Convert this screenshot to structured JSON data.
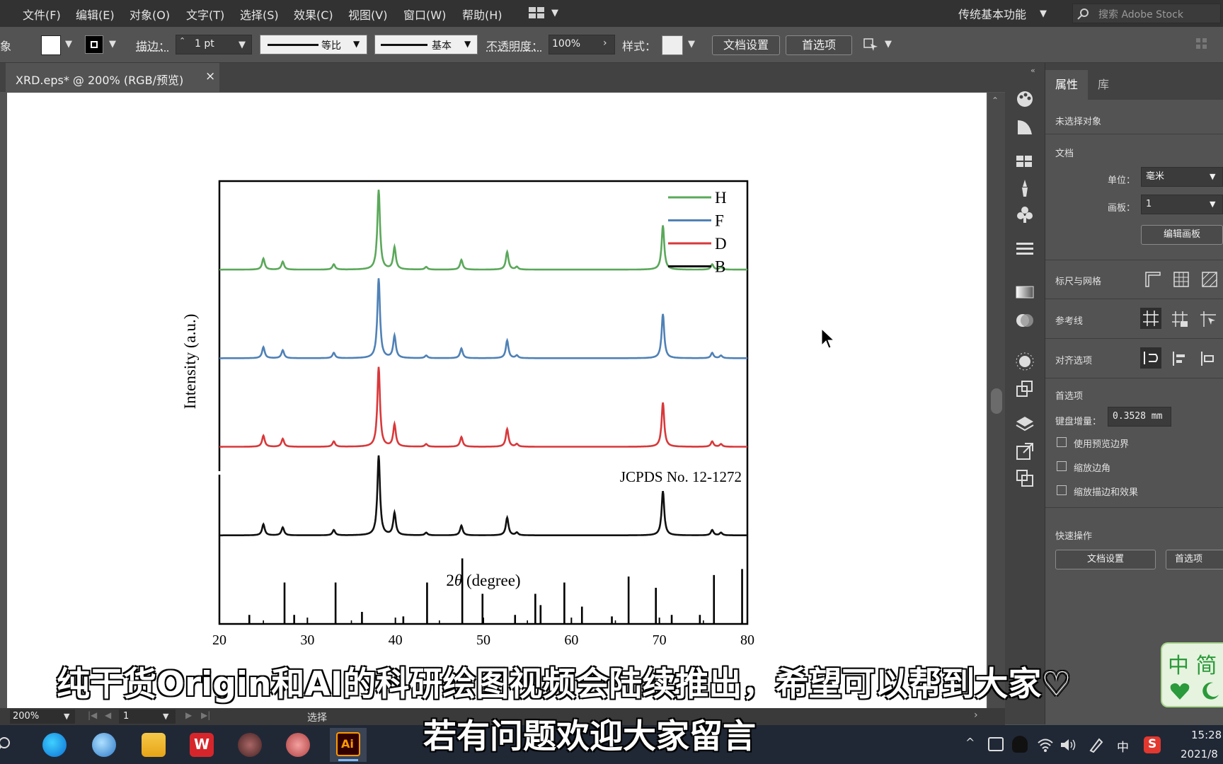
{
  "menubar": {
    "items": [
      "文件(F)",
      "编辑(E)",
      "对象(O)",
      "文字(T)",
      "选择(S)",
      "效果(C)",
      "视图(V)",
      "窗口(W)",
      "帮助(H)"
    ],
    "workspace": "传统基本功能",
    "search_placeholder": "搜索 Adobe Stock"
  },
  "controlbar": {
    "left_cut_label": "象",
    "stroke_label": "描边：",
    "stroke_weight": "1 pt",
    "profile_label": "等比",
    "brush_label": "基本",
    "opacity_label": "不透明度：",
    "opacity_value": "100%",
    "style_label": "样式：",
    "doc_setup_button": "文档设置",
    "prefs_button": "首选项"
  },
  "document_tab": {
    "title": "XRD.eps* @ 200% (RGB/预览)",
    "close": "×"
  },
  "chart_data": {
    "type": "line",
    "xlabel_prefix": "2",
    "xlabel_theta": "θ",
    "xlabel_rest": " (degree)",
    "ylabel": "Intensity (a.u.)",
    "xlim": [
      20,
      80
    ],
    "xticks": [
      "20",
      "30",
      "40",
      "50",
      "60",
      "70",
      "80"
    ],
    "reference_label": "JCPDS No. 12-1272",
    "series": [
      {
        "name": "H",
        "color": "#5aa85a",
        "baseline": 0.8,
        "offset_label_order": 0
      },
      {
        "name": "F",
        "color": "#4f81b6",
        "baseline": 0.6,
        "offset_label_order": 1
      },
      {
        "name": "D",
        "color": "#d9383a",
        "baseline": 0.4,
        "offset_label_order": 2
      },
      {
        "name": "B",
        "color": "#111111",
        "baseline": 0.2,
        "offset_label_order": 3
      }
    ],
    "peaks": [
      {
        "x": 25.0,
        "h": 0.025
      },
      {
        "x": 27.2,
        "h": 0.018
      },
      {
        "x": 33.0,
        "h": 0.012
      },
      {
        "x": 38.1,
        "h": 0.18
      },
      {
        "x": 39.9,
        "h": 0.05
      },
      {
        "x": 43.5,
        "h": 0.006
      },
      {
        "x": 47.5,
        "h": 0.022
      },
      {
        "x": 52.7,
        "h": 0.04
      },
      {
        "x": 53.8,
        "h": 0.006
      },
      {
        "x": 70.4,
        "h": 0.1
      },
      {
        "x": 76.0,
        "h": 0.012
      },
      {
        "x": 77.0,
        "h": 0.006
      }
    ],
    "reference_lines": [
      {
        "x": 23.4,
        "h": 0.12
      },
      {
        "x": 27.4,
        "h": 0.55
      },
      {
        "x": 28.5,
        "h": 0.12
      },
      {
        "x": 33.2,
        "h": 0.55
      },
      {
        "x": 36.2,
        "h": 0.16
      },
      {
        "x": 40.9,
        "h": 0.1
      },
      {
        "x": 43.6,
        "h": 0.55
      },
      {
        "x": 47.6,
        "h": 0.87
      },
      {
        "x": 49.9,
        "h": 0.4
      },
      {
        "x": 53.6,
        "h": 0.12
      },
      {
        "x": 55.9,
        "h": 0.4
      },
      {
        "x": 56.5,
        "h": 0.25
      },
      {
        "x": 59.2,
        "h": 0.55
      },
      {
        "x": 61.2,
        "h": 0.23
      },
      {
        "x": 64.6,
        "h": 0.1
      },
      {
        "x": 66.5,
        "h": 0.63
      },
      {
        "x": 69.6,
        "h": 0.48
      },
      {
        "x": 71.4,
        "h": 0.12
      },
      {
        "x": 74.6,
        "h": 0.12
      },
      {
        "x": 76.2,
        "h": 0.65
      },
      {
        "x": 79.4,
        "h": 0.73
      }
    ]
  },
  "panel": {
    "tab_properties": "属性",
    "tab_library": "库",
    "no_selection": "未选择对象",
    "document_section": "文档",
    "unit_label": "单位：",
    "unit_value": "毫米",
    "artboard_label": "画板：",
    "artboard_value": "1",
    "edit_artboards": "编辑画板",
    "rulers_grids": "标尺与网格",
    "guides": "参考线",
    "align_options": "对齐选项",
    "preferences": "首选项",
    "keyboard_increment_label": "键盘增量：",
    "keyboard_increment_value": "0.3528 mm",
    "use_preview_bounds": "使用预览边界",
    "scale_corners": "缩放边角",
    "scale_strokes_effects": "缩放描边和效果",
    "quick_actions": "快速操作",
    "doc_setup_button": "文档设置",
    "prefs_button_cut": "首选项"
  },
  "statusbar": {
    "zoom": "200%",
    "artboard": "1",
    "tool": "选择"
  },
  "ime": {
    "line1": "中 简"
  },
  "taskbar": {
    "time": "15:28",
    "date": "2021/8",
    "ime_lang": "中"
  },
  "subtitles": {
    "line1": "纯干货Origin和AI的科研绘图视频会陆续推出，希望可以帮到大家♡",
    "line2": "若有问题欢迎大家留言"
  }
}
